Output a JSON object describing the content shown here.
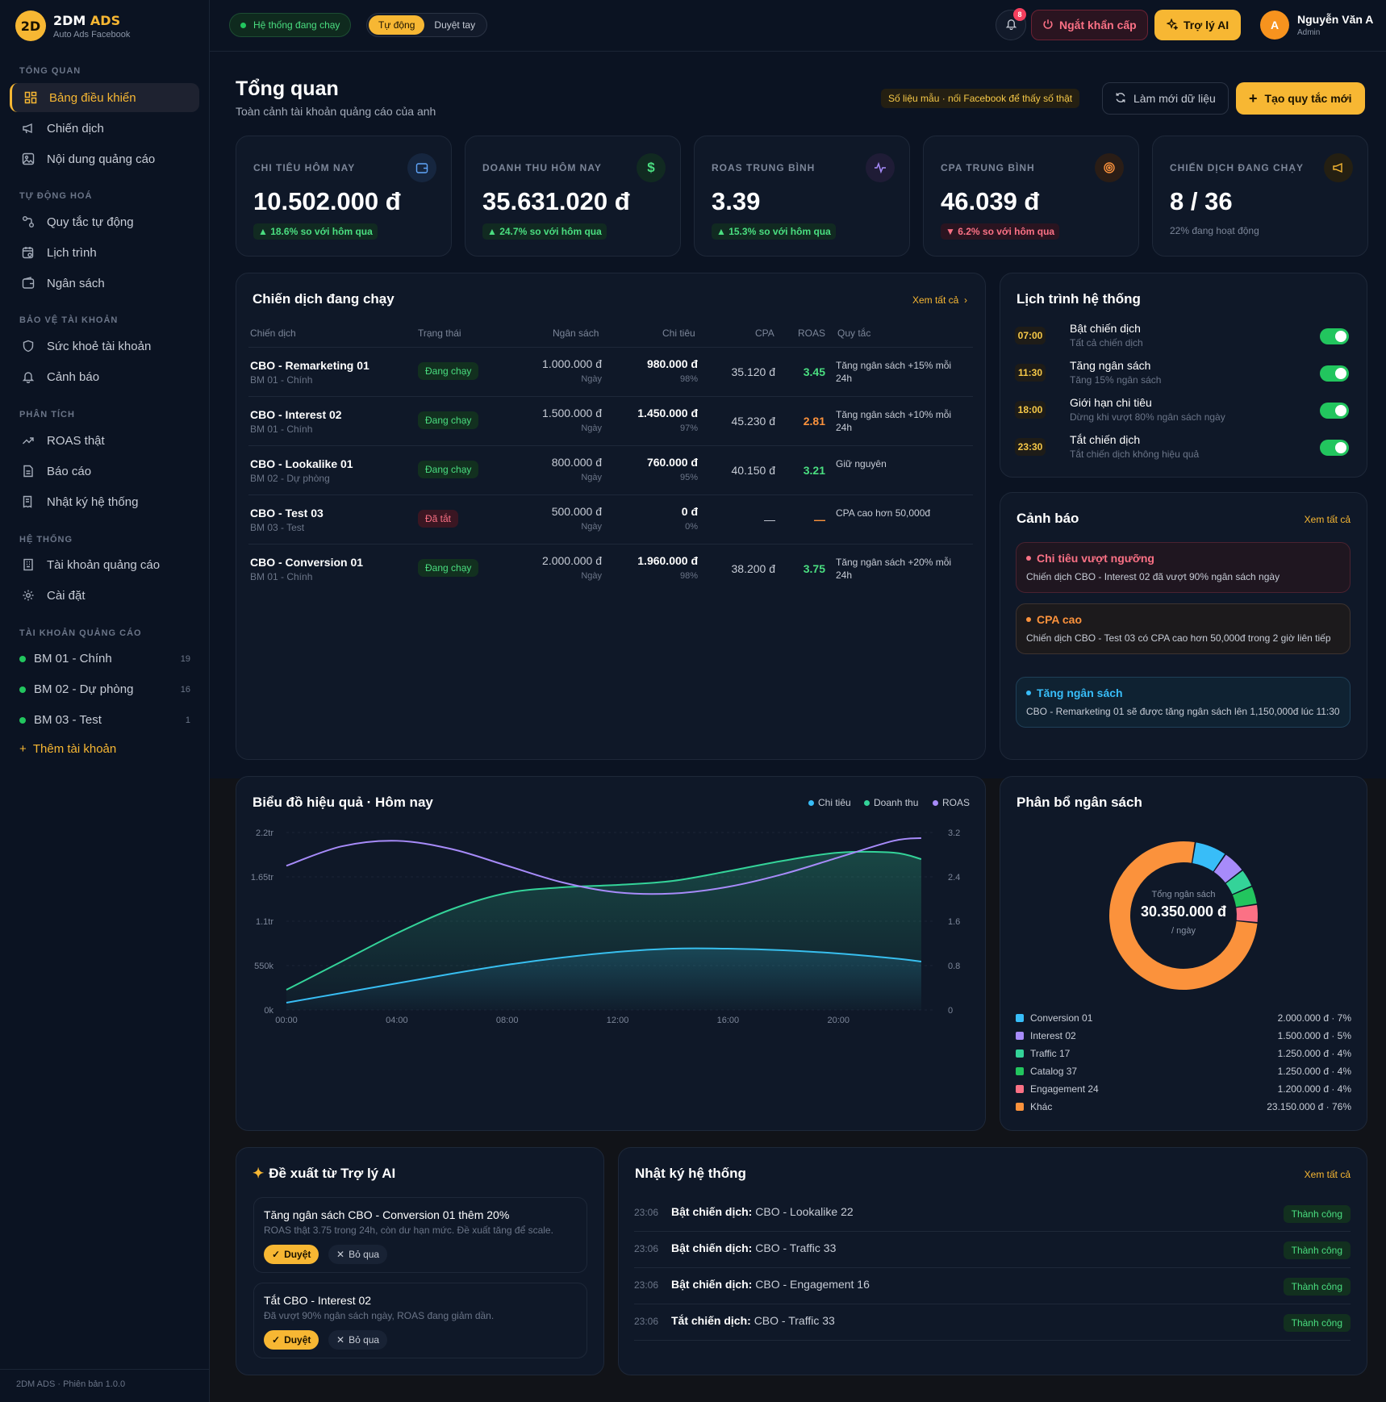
{
  "brand": {
    "name_a": "2DM",
    "name_b": "ADS",
    "logo": "2D",
    "sub": "Auto Ads Facebook"
  },
  "sidebar": {
    "sections": [
      "TỔNG QUAN",
      "TỰ ĐỘNG HOÁ",
      "BẢO VỆ TÀI KHOẢN",
      "PHÂN TÍCH",
      "HỆ THỐNG",
      "TÀI KHOẢN QUẢNG CÁO"
    ],
    "items": [
      {
        "label": "Bảng điều khiển",
        "icon": "dashboard-icon"
      },
      {
        "label": "Chiến dịch",
        "icon": "megaphone-icon"
      },
      {
        "label": "Nội dung quảng cáo",
        "icon": "image-icon"
      },
      {
        "label": "Quy tắc tự động",
        "icon": "workflow-icon"
      },
      {
        "label": "Lịch trình",
        "icon": "calendar-clock-icon"
      },
      {
        "label": "Ngân sách",
        "icon": "wallet-icon"
      },
      {
        "label": "Sức khoẻ tài khoản",
        "icon": "shield-icon"
      },
      {
        "label": "Cảnh báo",
        "icon": "bell-icon"
      },
      {
        "label": "ROAS thật",
        "icon": "trend-icon"
      },
      {
        "label": "Báo cáo",
        "icon": "document-icon"
      },
      {
        "label": "Nhật ký hệ thống",
        "icon": "receipt-icon"
      },
      {
        "label": "Tài khoản quảng cáo",
        "icon": "building-icon"
      },
      {
        "label": "Cài đặt",
        "icon": "gear-icon"
      }
    ],
    "accounts": [
      {
        "name": "BM 01 - Chính",
        "count": "19"
      },
      {
        "name": "BM 02 - Dự phòng",
        "count": "16"
      },
      {
        "name": "BM 03 - Test",
        "count": "1"
      }
    ],
    "add_account": "Thêm tài khoản",
    "version": "2DM ADS · Phiên bản 1.0.0"
  },
  "topbar": {
    "status": "Hệ thống đang chạy",
    "mode_auto": "Tự động",
    "mode_manual": "Duyệt tay",
    "notif_count": "8",
    "kill": "Ngắt khẩn cấp",
    "ai": "Trợ lý AI",
    "user_initial": "A",
    "user_name": "Nguyễn Văn A",
    "user_role": "Admin"
  },
  "header": {
    "title": "Tổng quan",
    "subtitle": "Toàn cảnh tài khoản quảng cáo của anh",
    "sample_badge": "Số liệu mẫu · nối Facebook để thấy số thật",
    "refresh": "Làm mới dữ liệu",
    "create": "Tạo quy tắc mới"
  },
  "kpis": [
    {
      "label": "CHI TIÊU HÔM NAY",
      "value": "10.502.000 đ",
      "change": "▲ 18.6% so với hôm qua",
      "dir": "up",
      "icon": "wallet-icon",
      "color": "#60a5fa"
    },
    {
      "label": "DOANH THU HÔM NAY",
      "value": "35.631.020 đ",
      "change": "▲ 24.7% so với hôm qua",
      "dir": "up",
      "icon": "dollar-icon",
      "color": "#4ade80"
    },
    {
      "label": "ROAS TRUNG BÌNH",
      "value": "3.39",
      "change": "▲ 15.3% so với hôm qua",
      "dir": "up",
      "icon": "pulse-icon",
      "color": "#a78bfa"
    },
    {
      "label": "CPA TRUNG BÌNH",
      "value": "46.039 đ",
      "change": "▼ 6.2% so với hôm qua",
      "dir": "down",
      "icon": "target-icon",
      "color": "#fb923c"
    },
    {
      "label": "CHIẾN DỊCH ĐANG CHẠY",
      "value": "8 / 36",
      "note": "22% đang hoạt động",
      "icon": "megaphone-icon",
      "color": "#f7b733"
    }
  ],
  "campaigns": {
    "title": "Chiến dịch đang chạy",
    "view_all": "Xem tất cả",
    "headers": [
      "Chiến dịch",
      "Trạng thái",
      "Ngân sách",
      "Chi tiêu",
      "CPA",
      "ROAS",
      "Quy tắc"
    ],
    "rows": [
      {
        "name": "CBO - Remarketing 01",
        "bm": "BM 01 - Chính",
        "status": "Đang chạy",
        "state": "run",
        "budget": "1.000.000 đ",
        "per": "Ngày",
        "spend": "980.000 đ",
        "pct": "98%",
        "cpa": "35.120 đ",
        "roas": "3.45",
        "roas_color": "#4ade80",
        "rule": "Tăng ngân sách +15% mỗi 24h"
      },
      {
        "name": "CBO - Interest 02",
        "bm": "BM 01 - Chính",
        "status": "Đang chạy",
        "state": "run",
        "budget": "1.500.000 đ",
        "per": "Ngày",
        "spend": "1.450.000 đ",
        "pct": "97%",
        "cpa": "45.230 đ",
        "roas": "2.81",
        "roas_color": "#fb923c",
        "rule": "Tăng ngân sách +10% mỗi 24h"
      },
      {
        "name": "CBO - Lookalike 01",
        "bm": "BM 02 - Dự phòng",
        "status": "Đang chạy",
        "state": "run",
        "budget": "800.000 đ",
        "per": "Ngày",
        "spend": "760.000 đ",
        "pct": "95%",
        "cpa": "40.150 đ",
        "roas": "3.21",
        "roas_color": "#4ade80",
        "rule": "Giữ nguyên"
      },
      {
        "name": "CBO - Test 03",
        "bm": "BM 03 - Test",
        "status": "Đã tắt",
        "state": "off",
        "budget": "500.000 đ",
        "per": "Ngày",
        "spend": "0 đ",
        "pct": "0%",
        "cpa": "—",
        "roas": "—",
        "roas_color": "#fb923c",
        "rule": "CPA cao hơn 50,000đ"
      },
      {
        "name": "CBO - Conversion 01",
        "bm": "BM 01 - Chính",
        "status": "Đang chạy",
        "state": "run",
        "budget": "2.000.000 đ",
        "per": "Ngày",
        "spend": "1.960.000 đ",
        "pct": "98%",
        "cpa": "38.200 đ",
        "roas": "3.75",
        "roas_color": "#4ade80",
        "rule": "Tăng ngân sách +20% mỗi 24h"
      }
    ]
  },
  "schedule": {
    "title": "Lịch trình hệ thống",
    "items": [
      {
        "time": "07:00",
        "title": "Bật chiến dịch",
        "desc": "Tất cả chiến dịch",
        "on": true
      },
      {
        "time": "11:30",
        "title": "Tăng ngân sách",
        "desc": "Tăng 15% ngân sách",
        "on": true
      },
      {
        "time": "18:00",
        "title": "Giới hạn chi tiêu",
        "desc": "Dừng khi vượt 80% ngân sách ngày",
        "on": true
      },
      {
        "time": "23:30",
        "title": "Tắt chiến dịch",
        "desc": "Tắt chiến dịch không hiệu quả",
        "on": true
      }
    ]
  },
  "alerts": {
    "title": "Cảnh báo",
    "view_all": "Xem tất cả",
    "items": [
      {
        "title": "Chi tiêu vượt ngưỡng",
        "desc": "Chiến dịch CBO - Interest 02 đã vượt 90% ngân sách ngày",
        "color": "#fb7185",
        "bg": "#1f1620",
        "border": "#4a2230"
      },
      {
        "title": "CPA cao",
        "desc": "Chiến dịch CBO - Test 03 có CPA cao hơn 50,000đ trong 2 giờ liên tiếp",
        "color": "#fb923c",
        "bg": "#1c1a1c",
        "border": "#3d3330"
      },
      {
        "title": "Tăng ngân sách",
        "desc": "CBO - Remarketing 01 sẽ được tăng ngân sách lên 1,150,000đ lúc 11:30",
        "color": "#38bdf8",
        "bg": "#0f2232",
        "border": "#1f4058"
      }
    ]
  },
  "chart_data": [
    {
      "type": "line",
      "title": "Biểu đồ hiệu quả · Hôm nay",
      "x": [
        "00:00",
        "02:00",
        "04:00",
        "06:00",
        "08:00",
        "10:00",
        "12:00",
        "14:00",
        "16:00",
        "18:00",
        "20:00",
        "22:00",
        "23:00"
      ],
      "x_ticks": [
        "00:00",
        "04:00",
        "08:00",
        "12:00",
        "16:00",
        "20:00"
      ],
      "y_left_ticks": [
        "0k",
        "550k",
        "1.1tr",
        "1.65tr",
        "2.2tr"
      ],
      "y_left_range": [
        0,
        2200000
      ],
      "y_right_ticks": [
        "0",
        "0.8",
        "1.6",
        "2.4",
        "3.2"
      ],
      "y_right_range": [
        0,
        3.2
      ],
      "series": [
        {
          "name": "Chi tiêu",
          "axis": "left",
          "color": "#38bdf8",
          "values": [
            90000,
            210000,
            330000,
            450000,
            560000,
            650000,
            720000,
            760000,
            760000,
            740000,
            700000,
            640000,
            600000
          ]
        },
        {
          "name": "Doanh thu",
          "axis": "left",
          "color": "#34d399",
          "values": [
            250000,
            600000,
            950000,
            1250000,
            1450000,
            1520000,
            1550000,
            1600000,
            1720000,
            1850000,
            1950000,
            1950000,
            1870000
          ]
        },
        {
          "name": "ROAS",
          "axis": "right",
          "color": "#a78bfa",
          "values": [
            2.6,
            2.95,
            3.05,
            2.9,
            2.6,
            2.3,
            2.12,
            2.1,
            2.22,
            2.45,
            2.75,
            3.05,
            3.1
          ]
        }
      ]
    },
    {
      "type": "pie",
      "title": "Phân bổ ngân sách",
      "center_label": "Tổng ngân sách",
      "center_value": "30.350.000 đ",
      "center_unit": "/ ngày",
      "slices": [
        {
          "name": "Conversion 01",
          "amount": "2.000.000 đ · 7%",
          "value": 7,
          "color": "#38bdf8"
        },
        {
          "name": "Interest 02",
          "amount": "1.500.000 đ · 5%",
          "value": 5,
          "color": "#a78bfa"
        },
        {
          "name": "Traffic 17",
          "amount": "1.250.000 đ · 4%",
          "value": 4,
          "color": "#34d399"
        },
        {
          "name": "Catalog 37",
          "amount": "1.250.000 đ · 4%",
          "value": 4,
          "color": "#22c55e"
        },
        {
          "name": "Engagement 24",
          "amount": "1.200.000 đ · 4%",
          "value": 4,
          "color": "#fb7185"
        },
        {
          "name": "Khác",
          "amount": "23.150.000 đ · 76%",
          "value": 76,
          "color": "#fb923c"
        }
      ]
    }
  ],
  "ai_suggestions": {
    "title": "Đề xuất từ Trợ lý AI",
    "approve": "Duyệt",
    "skip": "Bỏ qua",
    "items": [
      {
        "title": "Tăng ngân sách CBO - Conversion 01 thêm 20%",
        "desc": "ROAS thật 3.75 trong 24h, còn dư hạn mức. Đề xuất tăng để scale."
      },
      {
        "title": "Tắt CBO - Interest 02",
        "desc": "Đã vượt 90% ngân sách ngày, ROAS đang giảm dần."
      }
    ]
  },
  "logs": {
    "title": "Nhật ký hệ thống",
    "view_all": "Xem tất cả",
    "items": [
      {
        "time": "23:06",
        "action": "Bật chiến dịch:",
        "target": "CBO - Lookalike 22",
        "status": "Thành công"
      },
      {
        "time": "23:06",
        "action": "Bật chiến dịch:",
        "target": "CBO - Traffic 33",
        "status": "Thành công"
      },
      {
        "time": "23:06",
        "action": "Bật chiến dịch:",
        "target": "CBO - Engagement 16",
        "status": "Thành công"
      },
      {
        "time": "23:06",
        "action": "Tắt chiến dịch:",
        "target": "CBO - Traffic 33",
        "status": "Thành công"
      }
    ]
  }
}
